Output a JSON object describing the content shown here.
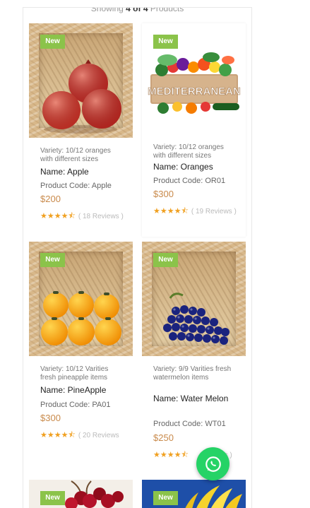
{
  "listing": {
    "showing_prefix": "Showing",
    "showing_count": "4 of 4",
    "showing_suffix": "Products"
  },
  "products": [
    {
      "badge": "New",
      "variety": "Variety: 10/12 oranges with different sizes",
      "name": "Name: Apple",
      "code": "Product Code: Apple",
      "price": "$200",
      "reviews": "( 18 Reviews )",
      "rating": 4.5,
      "image_icon": "pomegranate-crate-image"
    },
    {
      "badge": "New",
      "variety": "Variety: 10/12 oranges with different sizes",
      "name": "Name: Oranges",
      "code": "Product Code: OR01",
      "price": "$300",
      "reviews": "( 19 Reviews )",
      "rating": 4.5,
      "image_icon": "mediterranean-vegetables-image",
      "image_text": "MEDITERRANEAN"
    },
    {
      "badge": "New",
      "variety": "Variety: 10/12 Varities fresh pineapple items",
      "name": "Name: PineApple",
      "code": "Product Code: PA01",
      "price": "$300",
      "reviews": "( 20 Reviews",
      "rating": 4.5,
      "image_icon": "persimmon-crate-image"
    },
    {
      "badge": "New",
      "variety": "Variety: 9/9 Varities fresh watermelon items",
      "name": "Name: Water Melon",
      "code": "Product Code: WT01",
      "price": "$250",
      "reviews": "ews )",
      "rating": 4.5,
      "image_icon": "grapes-crate-image"
    },
    {
      "badge": "New",
      "image_icon": "cherries-image"
    },
    {
      "badge": "New",
      "image_icon": "bananas-image"
    }
  ],
  "whatsapp": {
    "icon": "whatsapp-icon",
    "color": "#25d366"
  },
  "colors": {
    "badge": "#8bc34a",
    "price": "#c98a4b",
    "stars": "#f0a020"
  }
}
